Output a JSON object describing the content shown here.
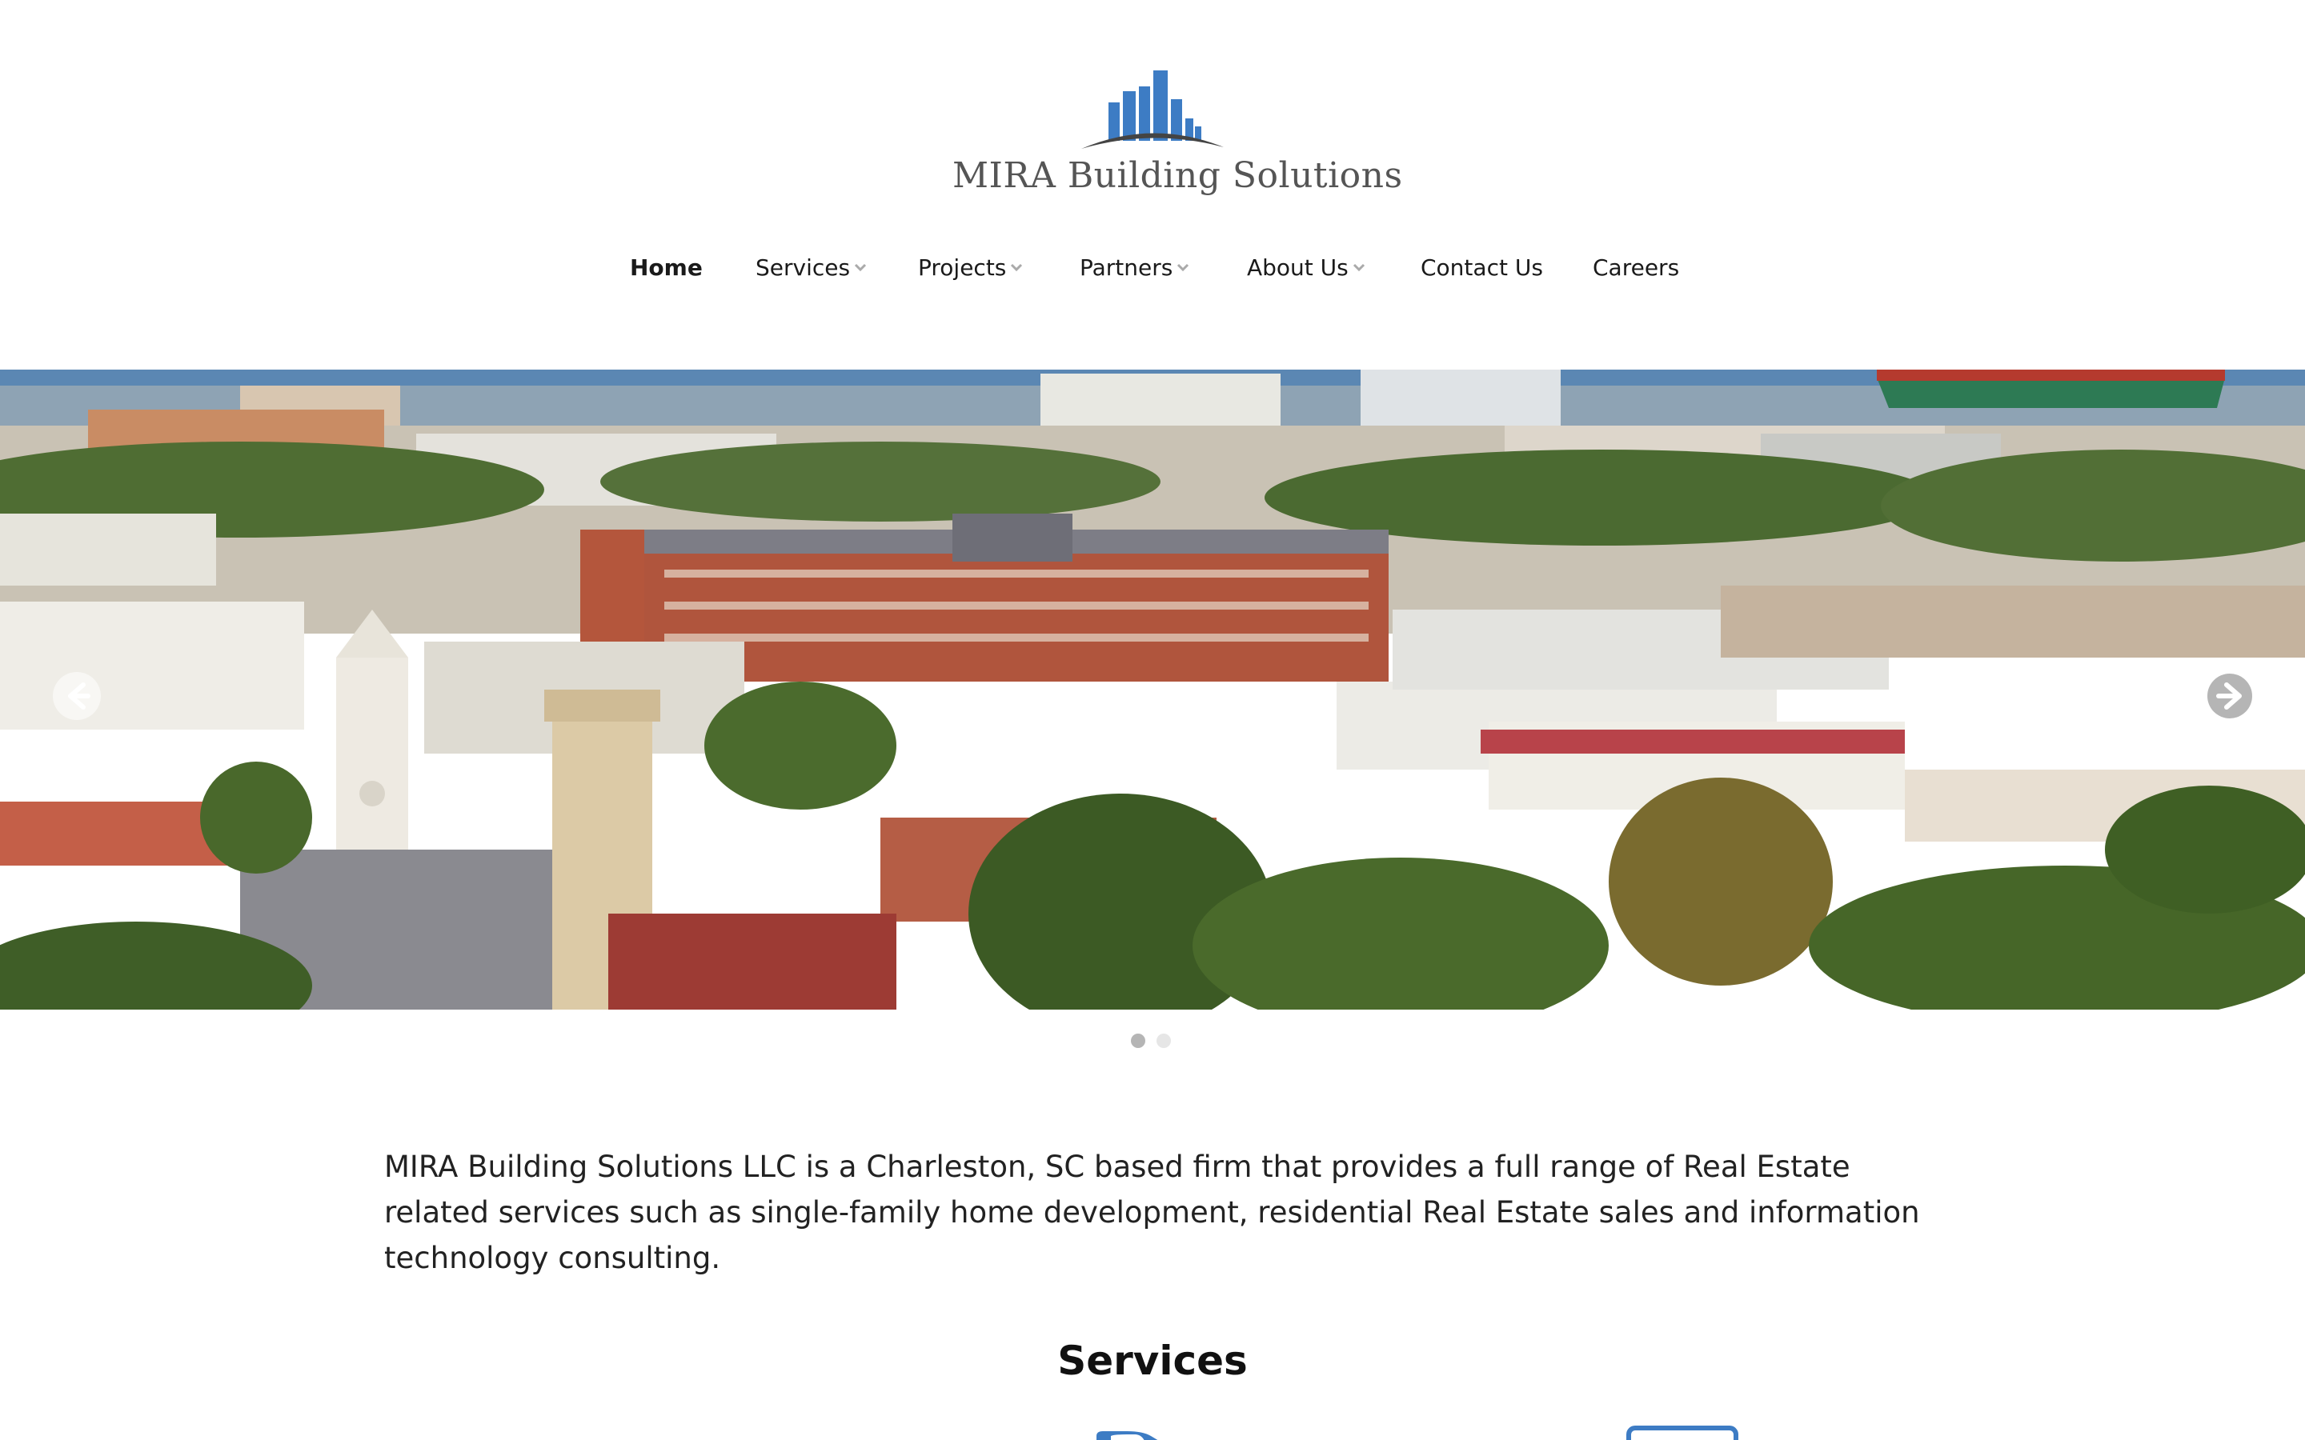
{
  "brand": {
    "name": "MIRA Building Solutions",
    "logo_icon": "city-skyline-logo",
    "color_primary": "#3d7cc4",
    "color_text": "#555555"
  },
  "nav": {
    "items": [
      {
        "label": "Home",
        "active": true,
        "has_dropdown": false
      },
      {
        "label": "Services",
        "active": false,
        "has_dropdown": true
      },
      {
        "label": "Projects",
        "active": false,
        "has_dropdown": true
      },
      {
        "label": "Partners",
        "active": false,
        "has_dropdown": true
      },
      {
        "label": "About Us",
        "active": false,
        "has_dropdown": true
      },
      {
        "label": "Contact Us",
        "active": false,
        "has_dropdown": false
      },
      {
        "label": "Careers",
        "active": false,
        "has_dropdown": false
      }
    ]
  },
  "slider": {
    "image_subject": "aerial view of Charleston cityscape",
    "prev_icon": "arrow-left-icon",
    "next_icon": "arrow-right-icon",
    "slide_count": 2,
    "active_slide": 1
  },
  "intro": {
    "text": "MIRA Building Solutions LLC is a Charleston, SC based firm that provides a full range of Real Estate related services such as single-family home development, residential Real Estate sales and information technology consulting."
  },
  "services": {
    "title": "Services"
  }
}
